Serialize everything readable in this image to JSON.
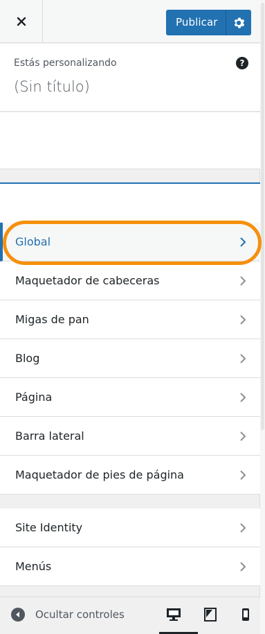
{
  "header": {
    "close_label": "×",
    "publish_label": "Publicar"
  },
  "info": {
    "customizing_label": "Estás personalizando",
    "site_title": "(Sin título)",
    "help_label": "?"
  },
  "menu_primary": [
    {
      "label": "Global",
      "active": true
    },
    {
      "label": "Maquetador de cabeceras"
    },
    {
      "label": "Migas de pan"
    },
    {
      "label": "Blog"
    },
    {
      "label": "Página"
    },
    {
      "label": "Barra lateral"
    },
    {
      "label": "Maquetador de pies de página"
    }
  ],
  "menu_secondary": [
    {
      "label": "Site Identity"
    },
    {
      "label": "Menús"
    }
  ],
  "footer": {
    "collapse_label": "Ocultar controles"
  },
  "colors": {
    "accent": "#2271b1",
    "highlight": "#f5900e"
  }
}
